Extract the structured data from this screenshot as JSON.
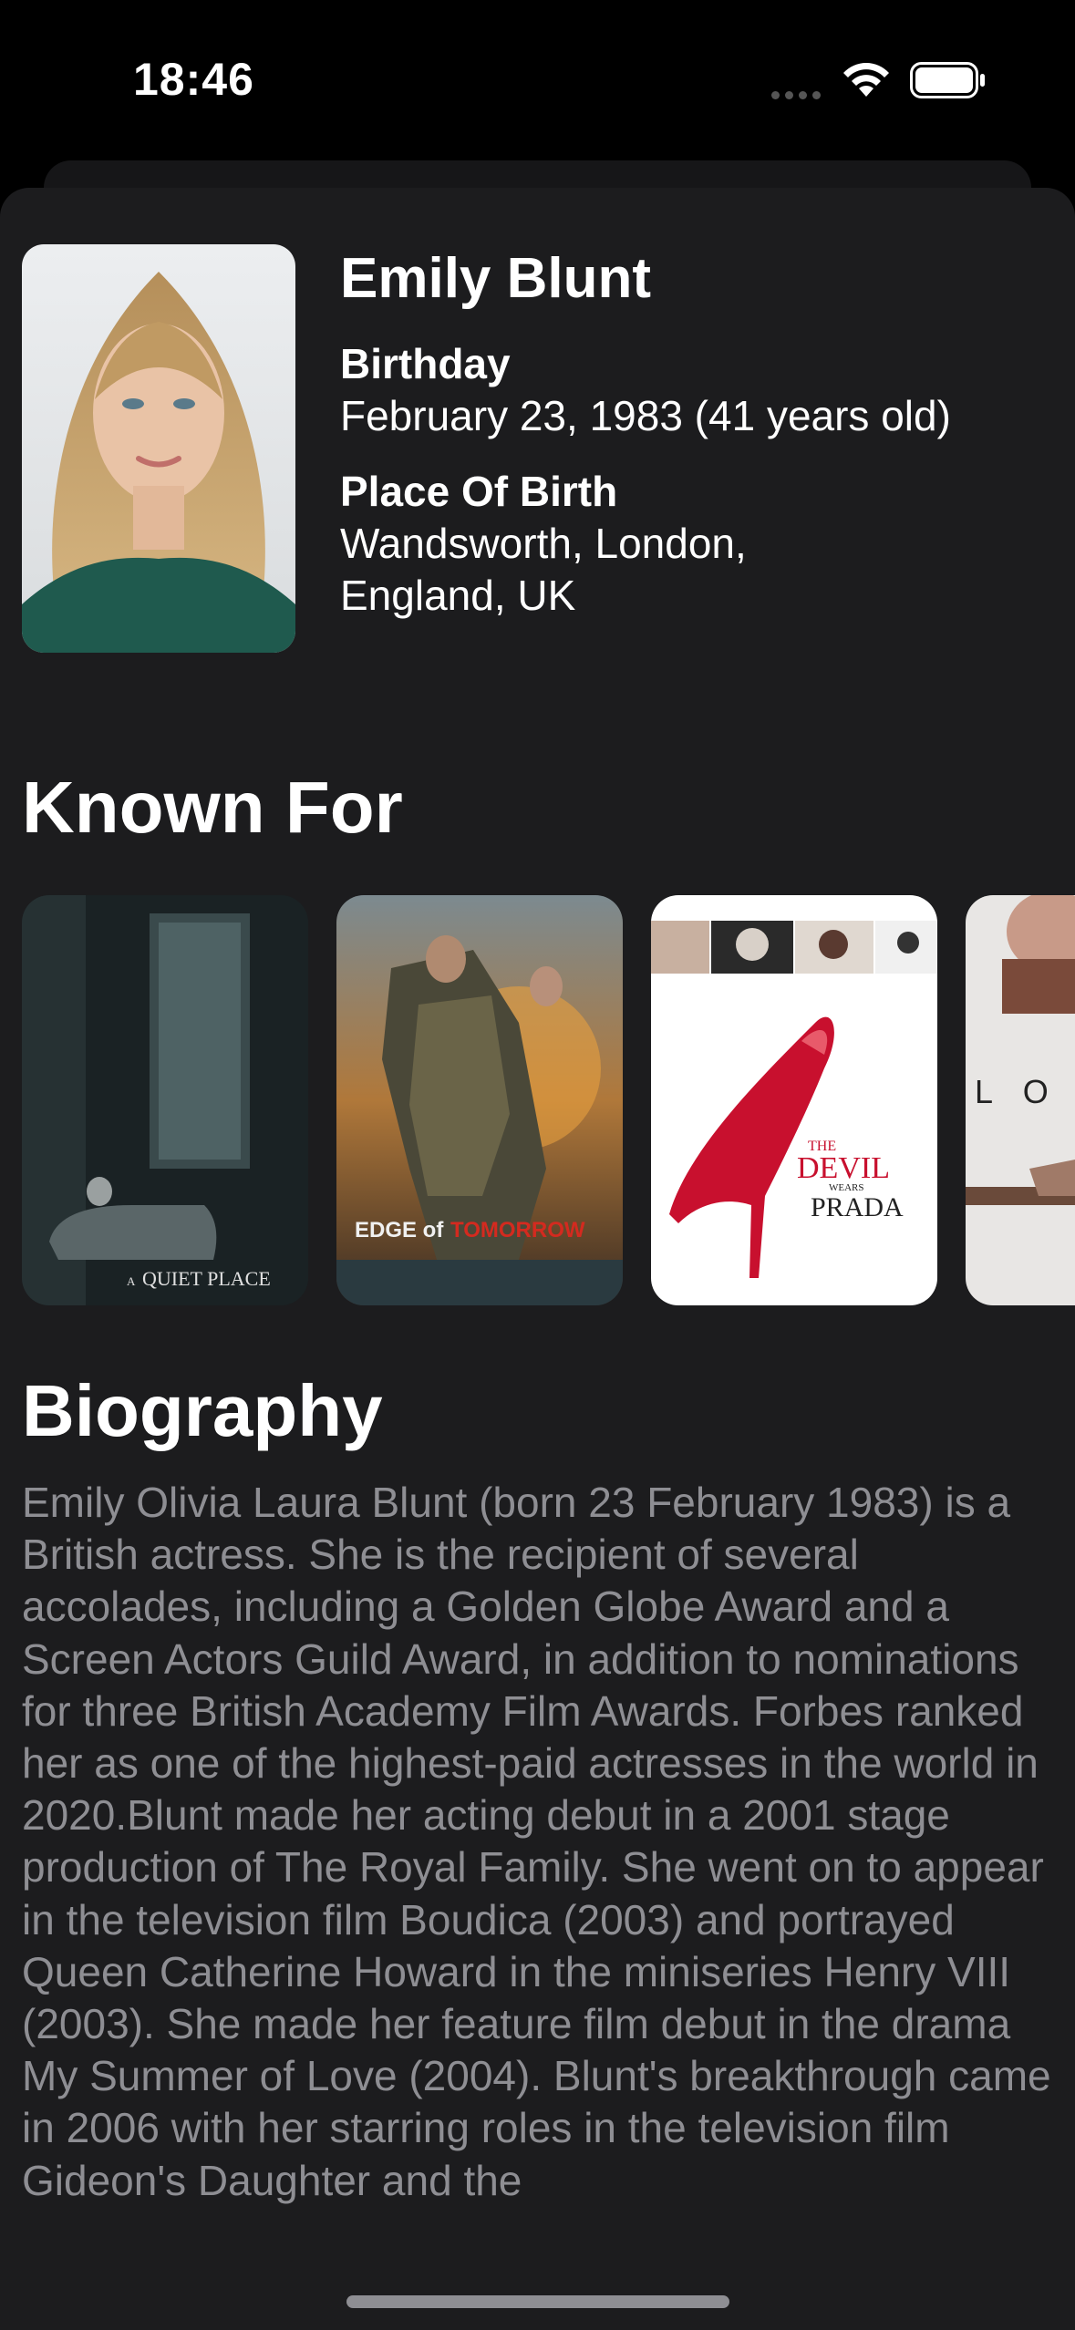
{
  "status_bar": {
    "time": "18:46"
  },
  "person": {
    "name": "Emily Blunt",
    "birthday_label": "Birthday",
    "birthday_value": "February 23, 1983 (41 years old)",
    "birthplace_label": "Place Of Birth",
    "birthplace_line1": "Wandsworth, London,",
    "birthplace_line2": "England, UK"
  },
  "known_for": {
    "title": "Known For",
    "posters": [
      {
        "title_line1": "A",
        "title_line2": "QUIET PLACE"
      },
      {
        "title_line1": "EDGE of",
        "title_line2": "TOMORROW"
      },
      {
        "title_line1": "THE",
        "title_line2": "DEVIL",
        "title_line3": "WEARS",
        "title_line4": "PRADA"
      },
      {
        "title_line1": "L O O"
      }
    ]
  },
  "biography": {
    "title": "Biography",
    "text": "Emily Olivia Laura Blunt (born 23 February 1983) is a British actress. She is the recipient of several accolades, including a Golden Globe Award and a Screen Actors Guild Award, in addition to nominations for three British Academy Film Awards. Forbes ranked her as one of the highest-paid actresses in the world in 2020.Blunt made her acting debut in a 2001 stage production of The Royal Family. She went on to appear in the television film Boudica (2003) and portrayed Queen Catherine Howard in the miniseries Henry VIII (2003). She made her feature film debut in the drama My Summer of Love (2004). Blunt's breakthrough came in 2006 with her starring roles in the television film Gideon's Daughter and the"
  },
  "colors": {
    "background": "#000000",
    "sheet": "#1c1c1e",
    "secondary_text": "#8e8e93",
    "accent_red": "#c8102e"
  },
  "icons": [
    "wifi-icon",
    "battery-icon",
    "cellular-icon"
  ]
}
